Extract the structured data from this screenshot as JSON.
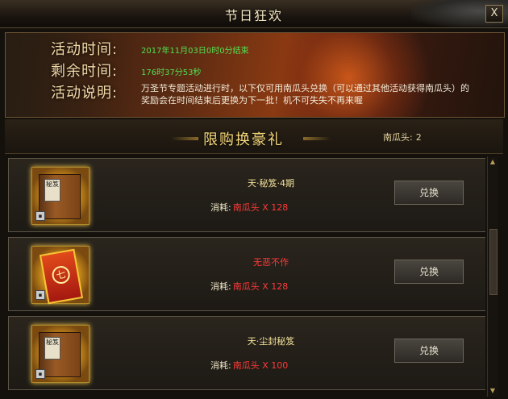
{
  "window": {
    "title": "节日狂欢",
    "close_label": "X"
  },
  "banner": {
    "time_label": "活动时间:",
    "time_value": "2017年11月03日0时0分结束",
    "remain_label": "剩余时间:",
    "remain_value": "176时37分53秒",
    "desc_label": "活动说明:",
    "desc_value": "万圣节专题活动进行时，以下仅可用南瓜头兑换（可以通过其他活动获得南瓜头）的奖励会在时间结束后更换为下一批！机不可失失不再来喔"
  },
  "section": {
    "title": "限购换豪礼",
    "counter_label": "南瓜头:",
    "counter_value": "2"
  },
  "items": [
    {
      "name": "天·秘笈·4期",
      "name_color": "#f2e19a",
      "cost_label": "消耗:",
      "cost_item": "南瓜头 X 128",
      "button": "兑换",
      "icon": "book-icon",
      "icon_tag": "秘笈"
    },
    {
      "name": "无恶不作",
      "name_color": "#ff3a3a",
      "cost_label": "消耗:",
      "cost_item": "南瓜头 X 128",
      "button": "兑换",
      "icon": "card-icon",
      "icon_tag": "七"
    },
    {
      "name": "天·尘封秘笈",
      "name_color": "#f2e19a",
      "cost_label": "消耗:",
      "cost_item": "南瓜头 X 100",
      "button": "兑换",
      "icon": "book-icon",
      "icon_tag": "秘笈"
    }
  ],
  "scrollbar": {
    "up": "▲",
    "down": "▼"
  }
}
